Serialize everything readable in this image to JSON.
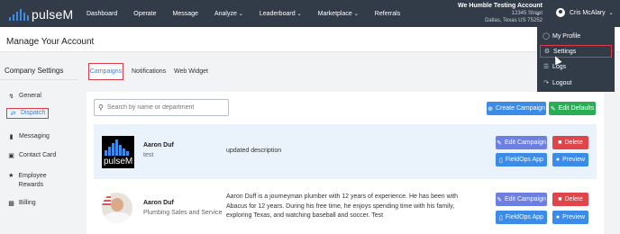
{
  "topbar": {
    "logo_text": "pulseM",
    "nav": [
      {
        "label": "Dashboard",
        "caret": false
      },
      {
        "label": "Operate",
        "caret": false
      },
      {
        "label": "Message",
        "caret": false
      },
      {
        "label": "Analyze",
        "caret": true
      },
      {
        "label": "Leaderboard",
        "caret": true
      },
      {
        "label": "Marketplace",
        "caret": true
      },
      {
        "label": "Referrals",
        "caret": false
      }
    ],
    "account": {
      "name": "We Humble Testing Account",
      "street": "12345 Street",
      "city": "Dallas, Texas US 75252"
    },
    "user_name": "Cris McAlary"
  },
  "dropdown": {
    "items": [
      {
        "label": "My Profile",
        "icon": "user-circle-icon"
      },
      {
        "label": "Settings",
        "icon": "gear-icon"
      },
      {
        "label": "Logs",
        "icon": "log-icon"
      },
      {
        "label": "Logout",
        "icon": "logout-icon"
      }
    ]
  },
  "page": {
    "title": "Manage Your Account"
  },
  "sidebar": {
    "heading": "Company Settings",
    "items": [
      {
        "label": "General",
        "icon": "chart-line-icon"
      },
      {
        "label": "Dispatch",
        "icon": "swap-icon"
      },
      {
        "label": "Messaging",
        "icon": "chat-icon"
      },
      {
        "label": "Contact Card",
        "icon": "id-card-icon"
      },
      {
        "label": "Employee Rewards",
        "icon": "trophy-icon"
      },
      {
        "label": "Billing",
        "icon": "wallet-icon"
      }
    ]
  },
  "tabs": [
    "Campaigns",
    "Notifications",
    "Web Widget"
  ],
  "toolbar": {
    "search_placeholder": "Search by name or department",
    "create_label": "Create Campaign",
    "defaults_label": "Edit Defaults"
  },
  "campaigns": [
    {
      "name": "Aaron Duf",
      "role": "test",
      "description": "updated description"
    },
    {
      "name": "Aaron Duf",
      "role": "Plumbing Sales and Service",
      "description": "Aaron Duff is a journeyman plumber with 12 years of experience. He has been with Abacus for 12 years. During his free time, he enjoys spending time with his family, exploring Texas, and watching baseball and soccer. Test"
    }
  ],
  "row_actions": {
    "edit": "Edit Campaign",
    "delete": "Delete",
    "app": "FieldOps App",
    "preview": "Preview"
  },
  "colors": {
    "nav_bg": "#323c48",
    "accent_blue": "#3b8be8",
    "highlight_red": "#d93b4a",
    "success_green": "#2aae55",
    "delete_red": "#e0454a",
    "edit_purple": "#6d7fe0"
  }
}
